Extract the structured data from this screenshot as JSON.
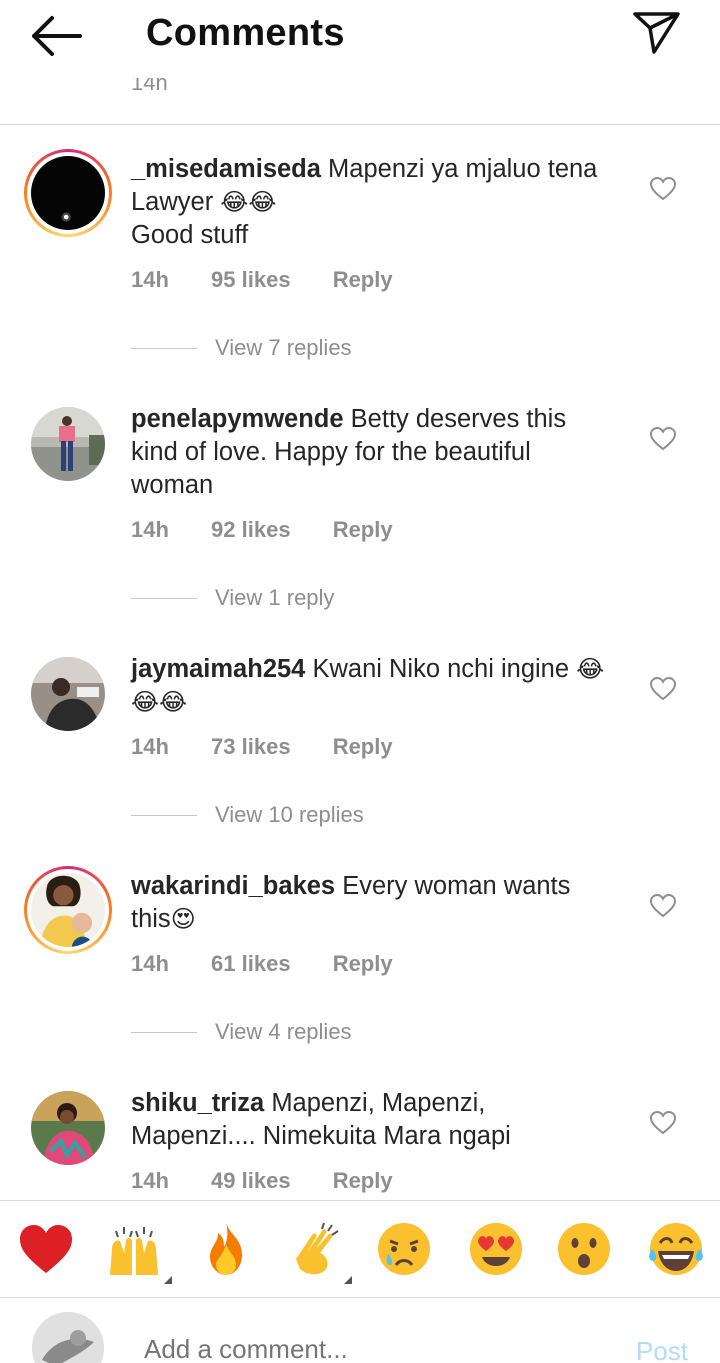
{
  "header": {
    "title": "Comments",
    "back_icon": "arrow-left-icon",
    "send_icon": "paper-plane-icon"
  },
  "cut_off": {
    "time": "14h"
  },
  "comments": [
    {
      "username": "_misedamiseda",
      "text": "Mapenzi ya mjaluo tena Lawyer",
      "emojis": "😂😂",
      "text2": "Good stuff",
      "time": "14h",
      "likes": "95 likes",
      "reply": "Reply",
      "view_replies": "View 7 replies"
    },
    {
      "username": "penelapymwende",
      "text": "Betty deserves this kind of love. Happy for the beautiful woman",
      "time": "14h",
      "likes": "92 likes",
      "reply": "Reply",
      "view_replies": "View 1 reply"
    },
    {
      "username": "jaymaimah254",
      "text": "Kwani Niko nchi ingine",
      "emojis": "😂😂😂",
      "time": "14h",
      "likes": "73 likes",
      "reply": "Reply",
      "view_replies": "View 10 replies"
    },
    {
      "username": "wakarindi_bakes",
      "text": "Every woman wants this",
      "emojis": "😍",
      "time": "14h",
      "likes": "61 likes",
      "reply": "Reply",
      "view_replies": "View 4 replies"
    },
    {
      "username": "shiku_triza",
      "text": "Mapenzi, Mapenzi, Mapenzi.... Nimekuita Mara ngapi",
      "time": "14h",
      "likes": "49 likes",
      "reply": "Reply"
    }
  ],
  "emoji_bar": [
    "red-heart",
    "raising-hands",
    "fire",
    "clapping-hands",
    "crying-face",
    "heart-eyes-face",
    "surprised-face",
    "tears-of-joy-face"
  ],
  "comment_bar": {
    "placeholder": "Add a comment...",
    "post_label": "Post"
  }
}
